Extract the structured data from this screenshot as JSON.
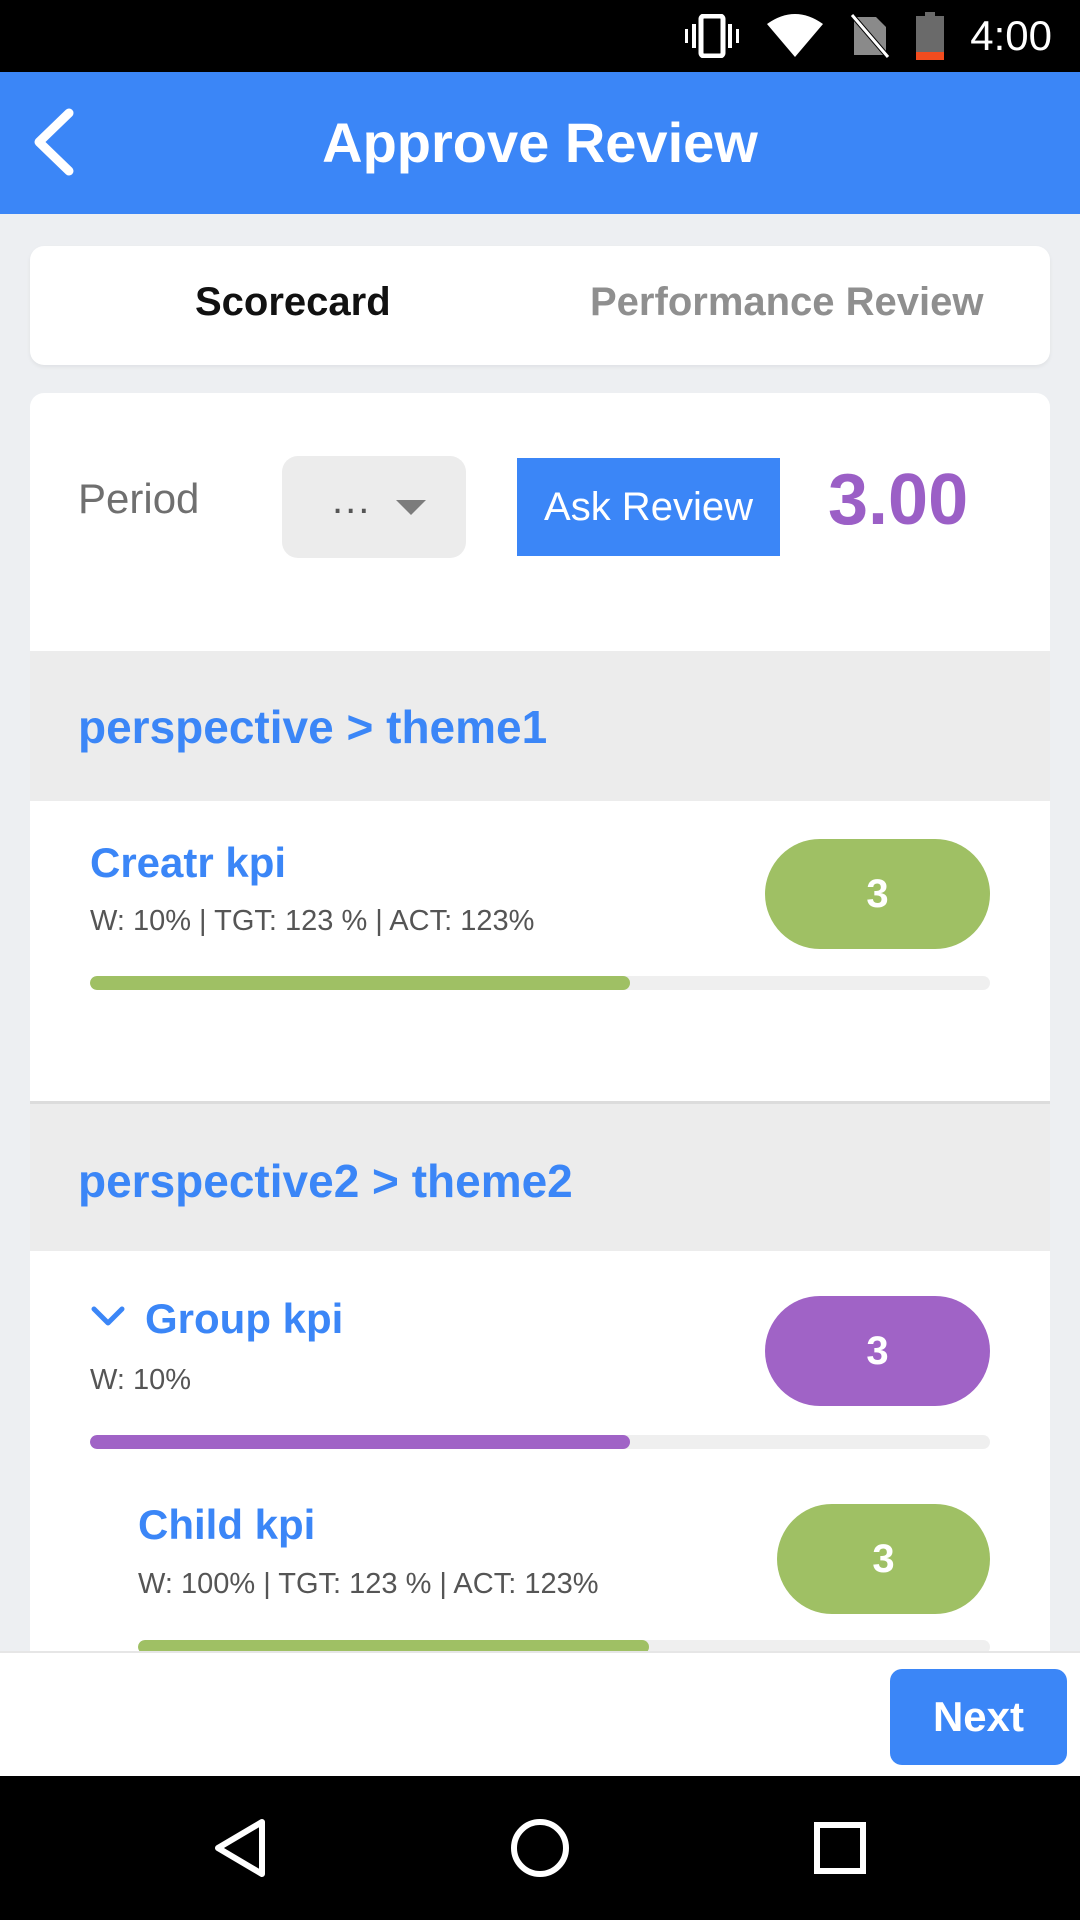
{
  "status_bar": {
    "time": "4:00",
    "icons": [
      "vibrate-icon",
      "wifi-icon",
      "no-sim-icon",
      "battery-low-icon"
    ]
  },
  "header": {
    "title": "Approve Review",
    "back_icon": "chevron-left-icon"
  },
  "tabs": [
    {
      "label": "Scorecard",
      "active": true
    },
    {
      "label": "Performance Review",
      "active": false
    }
  ],
  "controls": {
    "period_label": "Period",
    "period_value": "...",
    "ask_review_label": "Ask Review",
    "total_score": "3.00"
  },
  "sections": [
    {
      "title": "perspective > theme1",
      "kpis": [
        {
          "title": "Creatr kpi",
          "meta": "W: 10% | TGT: 123 % | ACT: 123%",
          "score": "3",
          "color": "#9fc064",
          "progress": 0.6
        }
      ]
    },
    {
      "title": "perspective2 > theme2",
      "kpis": [
        {
          "title": "Group kpi",
          "meta": "W: 10%",
          "score": "3",
          "color": "#a063c6",
          "progress": 0.6,
          "expanded": true,
          "icon": "chevron-down-icon"
        },
        {
          "title": "Child kpi",
          "meta": "W: 100% | TGT: 123 % | ACT: 123%",
          "score": "3",
          "color": "#9fc064",
          "progress": 0.6
        }
      ]
    }
  ],
  "footer": {
    "next_label": "Next"
  },
  "nav": [
    "back-triangle-icon",
    "home-circle-icon",
    "recents-square-icon"
  ]
}
